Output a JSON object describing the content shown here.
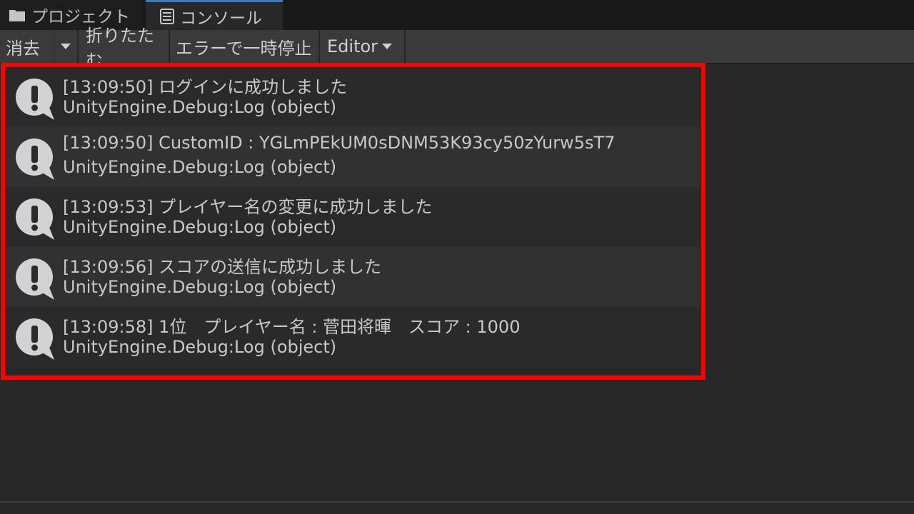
{
  "tabs": {
    "project": {
      "label": "プロジェクト",
      "icon": "folder-icon"
    },
    "console": {
      "label": "コンソール",
      "icon": "console-icon",
      "active": true
    }
  },
  "toolbar": {
    "clear_label": "消去",
    "collapse_label": "折りたたむ",
    "error_pause_label": "エラーで一時停止",
    "editor_label": "Editor"
  },
  "logs": [
    {
      "line1": "[13:09:50] ログインに成功しました",
      "line2": "UnityEngine.Debug:Log (object)",
      "icon": "info-log-icon"
    },
    {
      "line1": "[13:09:50] CustomID : YGLmPEkUM0sDNM53K93cy50zYurw5sT7",
      "line2": "UnityEngine.Debug:Log (object)",
      "icon": "info-log-icon"
    },
    {
      "line1": "[13:09:53] プレイヤー名の変更に成功しました",
      "line2": "UnityEngine.Debug:Log (object)",
      "icon": "info-log-icon"
    },
    {
      "line1": "[13:09:56] スコアの送信に成功しました",
      "line2": "UnityEngine.Debug:Log (object)",
      "icon": "info-log-icon"
    },
    {
      "line1": "[13:09:58] 1位　プレイヤー名 : 菅田将暉　スコア : 1000",
      "line2": "UnityEngine.Debug:Log (object)",
      "icon": "info-log-icon"
    }
  ],
  "colors": {
    "highlight": "#ff0000",
    "tab_active_accent": "#3a79bb",
    "background": "#282828"
  }
}
